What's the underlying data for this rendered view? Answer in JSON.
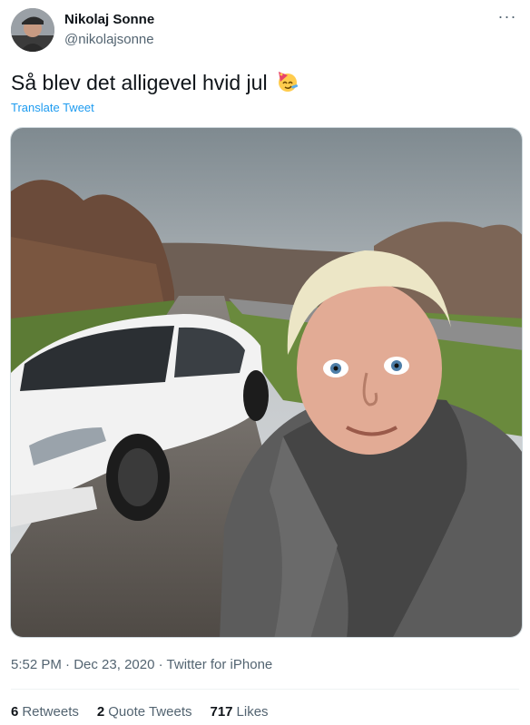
{
  "author": {
    "display_name": "Nikolaj Sonne",
    "handle": "@nikolajsonne",
    "avatar_icon": "profile-avatar"
  },
  "more_icon": "more-dots-icon",
  "tweet": {
    "text": "Så blev det alligevel hvid jul",
    "emoji_icon": "party-face-icon",
    "translate_label": "Translate Tweet",
    "media_description_icon": "photo-selfie-with-car"
  },
  "meta": {
    "time": "5:52 PM",
    "separator1": "·",
    "date": "Dec 23, 2020",
    "separator2": "·",
    "source": "Twitter for iPhone"
  },
  "stats": [
    {
      "count": "6",
      "label": "Retweets"
    },
    {
      "count": "2",
      "label": "Quote Tweets"
    },
    {
      "count": "717",
      "label": "Likes"
    }
  ],
  "colors": {
    "link": "#1d9bf0",
    "secondary_text": "#536471",
    "primary_text": "#0f1419"
  }
}
